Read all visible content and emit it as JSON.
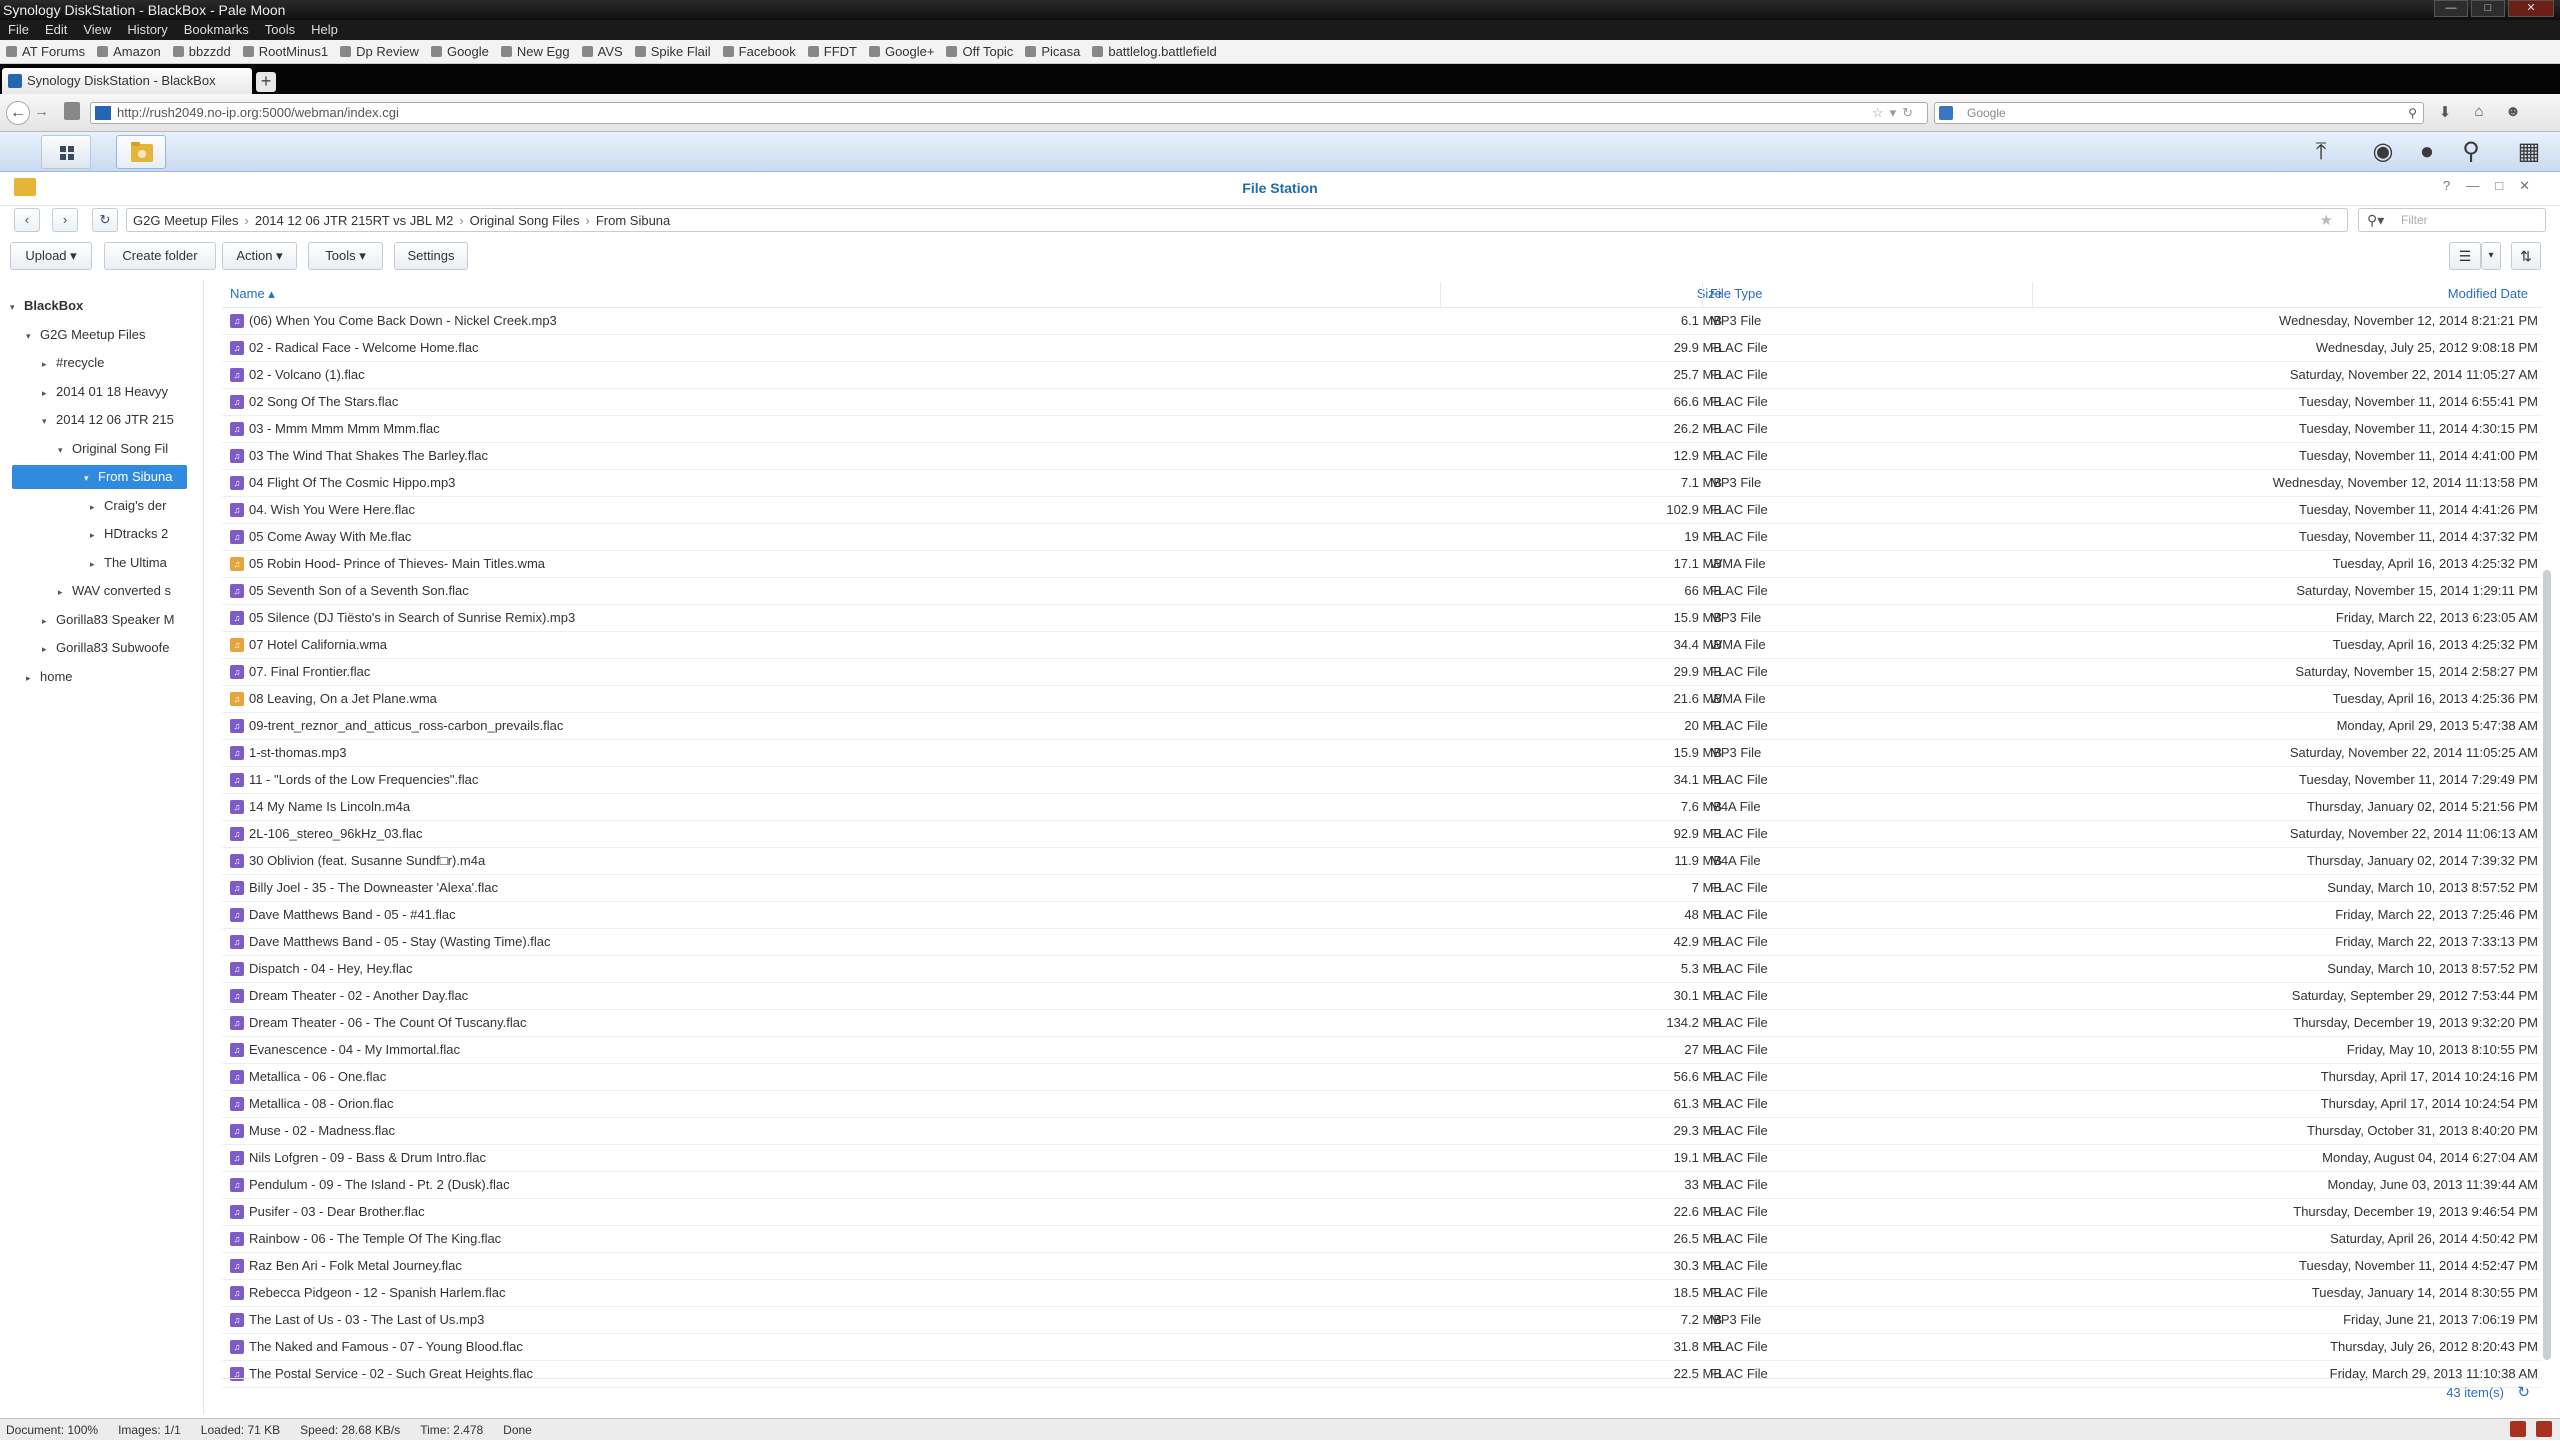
{
  "window": {
    "title": "Synology DiskStation - BlackBox - Pale Moon"
  },
  "menu": [
    "File",
    "Edit",
    "View",
    "History",
    "Bookmarks",
    "Tools",
    "Help"
  ],
  "bookmarks": [
    "AT Forums",
    "Amazon",
    "bbzzdd",
    "RootMinus1",
    "Dp Review",
    "Google",
    "New Egg",
    "AVS",
    "Spike Flail",
    "Facebook",
    "FFDT",
    "Google+",
    "Off Topic",
    "Picasa",
    "battlelog.battlefield"
  ],
  "tab": {
    "label": "Synology DiskStation - BlackBox"
  },
  "url": "http://rush2049.no-ip.org:5000/webman/index.cgi",
  "search_placeholder": "Google",
  "app": {
    "title": "File Station"
  },
  "breadcrumb": [
    "G2G Meetup Files",
    "2014 12 06 JTR 215RT vs JBL M2",
    "Original Song Files",
    "From Sibuna"
  ],
  "filter_placeholder": "Filter",
  "toolbar": {
    "upload": "Upload",
    "create_folder": "Create folder",
    "action": "Action",
    "tools": "Tools",
    "settings": "Settings"
  },
  "tree": [
    {
      "label": "BlackBox",
      "arrow": "▾",
      "level": 0
    },
    {
      "label": "G2G Meetup Files",
      "arrow": "▾",
      "level": 1
    },
    {
      "label": "#recycle",
      "arrow": "▸",
      "level": 2
    },
    {
      "label": "2014 01 18 Heavyy",
      "arrow": "▸",
      "level": 2
    },
    {
      "label": "2014 12 06 JTR 215",
      "arrow": "▾",
      "level": 2
    },
    {
      "label": "Original Song Fil",
      "arrow": "▾",
      "level": 3
    },
    {
      "label": "From Sibuna",
      "arrow": "▾",
      "level": 4,
      "selected": true
    },
    {
      "label": "Craig's der",
      "arrow": "▸",
      "level": 5
    },
    {
      "label": "HDtracks 2",
      "arrow": "▸",
      "level": 5
    },
    {
      "label": "The Ultima",
      "arrow": "▸",
      "level": 5
    },
    {
      "label": "WAV converted s",
      "arrow": "▸",
      "level": 3
    },
    {
      "label": "Gorilla83 Speaker M",
      "arrow": "▸",
      "level": 2
    },
    {
      "label": "Gorilla83 Subwoofe",
      "arrow": "▸",
      "level": 2
    },
    {
      "label": "home",
      "arrow": "▸",
      "level": 1
    }
  ],
  "columns": {
    "name": "Name ▴",
    "size": "Size",
    "type": "File Type",
    "modified": "Modified Date"
  },
  "files": [
    {
      "name": "(06) When You Come Back Down - Nickel Creek.mp3",
      "size": "6.1 MB",
      "type": "MP3 File",
      "modified": "Wednesday, November 12, 2014 8:21:21 PM"
    },
    {
      "name": "02 - Radical Face - Welcome Home.flac",
      "size": "29.9 MB",
      "type": "FLAC File",
      "modified": "Wednesday, July 25, 2012 9:08:18 PM"
    },
    {
      "name": "02 - Volcano (1).flac",
      "size": "25.7 MB",
      "type": "FLAC File",
      "modified": "Saturday, November 22, 2014 11:05:27 AM"
    },
    {
      "name": "02 Song Of The Stars.flac",
      "size": "66.6 MB",
      "type": "FLAC File",
      "modified": "Tuesday, November 11, 2014 6:55:41 PM"
    },
    {
      "name": "03 - Mmm Mmm Mmm Mmm.flac",
      "size": "26.2 MB",
      "type": "FLAC File",
      "modified": "Tuesday, November 11, 2014 4:30:15 PM"
    },
    {
      "name": "03 The Wind That Shakes The Barley.flac",
      "size": "12.9 MB",
      "type": "FLAC File",
      "modified": "Tuesday, November 11, 2014 4:41:00 PM"
    },
    {
      "name": "04 Flight Of The Cosmic Hippo.mp3",
      "size": "7.1 MB",
      "type": "MP3 File",
      "modified": "Wednesday, November 12, 2014 11:13:58 PM"
    },
    {
      "name": "04. Wish You Were Here.flac",
      "size": "102.9 MB",
      "type": "FLAC File",
      "modified": "Tuesday, November 11, 2014 4:41:26 PM"
    },
    {
      "name": "05 Come Away With Me.flac",
      "size": "19 MB",
      "type": "FLAC File",
      "modified": "Tuesday, November 11, 2014 4:37:32 PM"
    },
    {
      "name": "05 Robin Hood- Prince of Thieves- Main Titles.wma",
      "size": "17.1 MB",
      "type": "WMA File",
      "modified": "Tuesday, April 16, 2013 4:25:32 PM"
    },
    {
      "name": "05 Seventh Son of a Seventh Son.flac",
      "size": "66 MB",
      "type": "FLAC File",
      "modified": "Saturday, November 15, 2014 1:29:11 PM"
    },
    {
      "name": "05 Silence (DJ Tiësto's in Search of Sunrise Remix).mp3",
      "size": "15.9 MB",
      "type": "MP3 File",
      "modified": "Friday, March 22, 2013 6:23:05 AM"
    },
    {
      "name": "07 Hotel California.wma",
      "size": "34.4 MB",
      "type": "WMA File",
      "modified": "Tuesday, April 16, 2013 4:25:32 PM"
    },
    {
      "name": "07. Final Frontier.flac",
      "size": "29.9 MB",
      "type": "FLAC File",
      "modified": "Saturday, November 15, 2014 2:58:27 PM"
    },
    {
      "name": "08 Leaving, On a Jet Plane.wma",
      "size": "21.6 MB",
      "type": "WMA File",
      "modified": "Tuesday, April 16, 2013 4:25:36 PM"
    },
    {
      "name": "09-trent_reznor_and_atticus_ross-carbon_prevails.flac",
      "size": "20 MB",
      "type": "FLAC File",
      "modified": "Monday, April 29, 2013 5:47:38 AM"
    },
    {
      "name": "1-st-thomas.mp3",
      "size": "15.9 MB",
      "type": "MP3 File",
      "modified": "Saturday, November 22, 2014 11:05:25 AM"
    },
    {
      "name": "11 - \"Lords of the Low Frequencies\".flac",
      "size": "34.1 MB",
      "type": "FLAC File",
      "modified": "Tuesday, November 11, 2014 7:29:49 PM"
    },
    {
      "name": "14 My Name Is Lincoln.m4a",
      "size": "7.6 MB",
      "type": "M4A File",
      "modified": "Thursday, January 02, 2014 5:21:56 PM"
    },
    {
      "name": "2L-106_stereo_96kHz_03.flac",
      "size": "92.9 MB",
      "type": "FLAC File",
      "modified": "Saturday, November 22, 2014 11:06:13 AM"
    },
    {
      "name": "30 Oblivion (feat. Susanne Sundf□r).m4a",
      "size": "11.9 MB",
      "type": "M4A File",
      "modified": "Thursday, January 02, 2014 7:39:32 PM"
    },
    {
      "name": "Billy Joel - 35 - The Downeaster 'Alexa'.flac",
      "size": "7 MB",
      "type": "FLAC File",
      "modified": "Sunday, March 10, 2013 8:57:52 PM"
    },
    {
      "name": "Dave Matthews Band - 05 - #41.flac",
      "size": "48 MB",
      "type": "FLAC File",
      "modified": "Friday, March 22, 2013 7:25:46 PM"
    },
    {
      "name": "Dave Matthews Band - 05 - Stay (Wasting Time).flac",
      "size": "42.9 MB",
      "type": "FLAC File",
      "modified": "Friday, March 22, 2013 7:33:13 PM"
    },
    {
      "name": "Dispatch - 04 - Hey, Hey.flac",
      "size": "5.3 MB",
      "type": "FLAC File",
      "modified": "Sunday, March 10, 2013 8:57:52 PM"
    },
    {
      "name": "Dream Theater - 02 - Another Day.flac",
      "size": "30.1 MB",
      "type": "FLAC File",
      "modified": "Saturday, September 29, 2012 7:53:44 PM"
    },
    {
      "name": "Dream Theater - 06 - The Count Of Tuscany.flac",
      "size": "134.2 MB",
      "type": "FLAC File",
      "modified": "Thursday, December 19, 2013 9:32:20 PM"
    },
    {
      "name": "Evanescence - 04 - My Immortal.flac",
      "size": "27 MB",
      "type": "FLAC File",
      "modified": "Friday, May 10, 2013 8:10:55 PM"
    },
    {
      "name": "Metallica - 06 - One.flac",
      "size": "56.6 MB",
      "type": "FLAC File",
      "modified": "Thursday, April 17, 2014 10:24:16 PM"
    },
    {
      "name": "Metallica - 08 - Orion.flac",
      "size": "61.3 MB",
      "type": "FLAC File",
      "modified": "Thursday, April 17, 2014 10:24:54 PM"
    },
    {
      "name": "Muse - 02 - Madness.flac",
      "size": "29.3 MB",
      "type": "FLAC File",
      "modified": "Thursday, October 31, 2013 8:40:20 PM"
    },
    {
      "name": "Nils Lofgren - 09 - Bass & Drum Intro.flac",
      "size": "19.1 MB",
      "type": "FLAC File",
      "modified": "Monday, August 04, 2014 6:27:04 AM"
    },
    {
      "name": "Pendulum - 09 - The Island - Pt. 2 (Dusk).flac",
      "size": "33 MB",
      "type": "FLAC File",
      "modified": "Monday, June 03, 2013 11:39:44 AM"
    },
    {
      "name": "Pusifer - 03 - Dear Brother.flac",
      "size": "22.6 MB",
      "type": "FLAC File",
      "modified": "Thursday, December 19, 2013 9:46:54 PM"
    },
    {
      "name": "Rainbow - 06 - The Temple Of The King.flac",
      "size": "26.5 MB",
      "type": "FLAC File",
      "modified": "Saturday, April 26, 2014 4:50:42 PM"
    },
    {
      "name": "Raz Ben Ari - Folk Metal Journey.flac",
      "size": "30.3 MB",
      "type": "FLAC File",
      "modified": "Tuesday, November 11, 2014 4:52:47 PM"
    },
    {
      "name": "Rebecca Pidgeon - 12 - Spanish Harlem.flac",
      "size": "18.5 MB",
      "type": "FLAC File",
      "modified": "Tuesday, January 14, 2014 8:30:55 PM"
    },
    {
      "name": "The Last of Us - 03 - The Last of Us.mp3",
      "size": "7.2 MB",
      "type": "MP3 File",
      "modified": "Friday, June 21, 2013 7:06:19 PM"
    },
    {
      "name": "The Naked and Famous - 07 - Young Blood.flac",
      "size": "31.8 MB",
      "type": "FLAC File",
      "modified": "Thursday, July 26, 2012 8:20:43 PM"
    },
    {
      "name": "The Postal Service - 02 - Such Great Heights.flac",
      "size": "22.5 MB",
      "type": "FLAC File",
      "modified": "Friday, March 29, 2013 11:10:38 AM"
    }
  ],
  "item_count": "43 item(s)",
  "status": {
    "document": "Document: 100%",
    "images": "Images: 1/1",
    "loaded": "Loaded: 71 KB",
    "speed": "Speed: 28.68 KB/s",
    "time": "Time: 2.478",
    "state": "Done"
  }
}
